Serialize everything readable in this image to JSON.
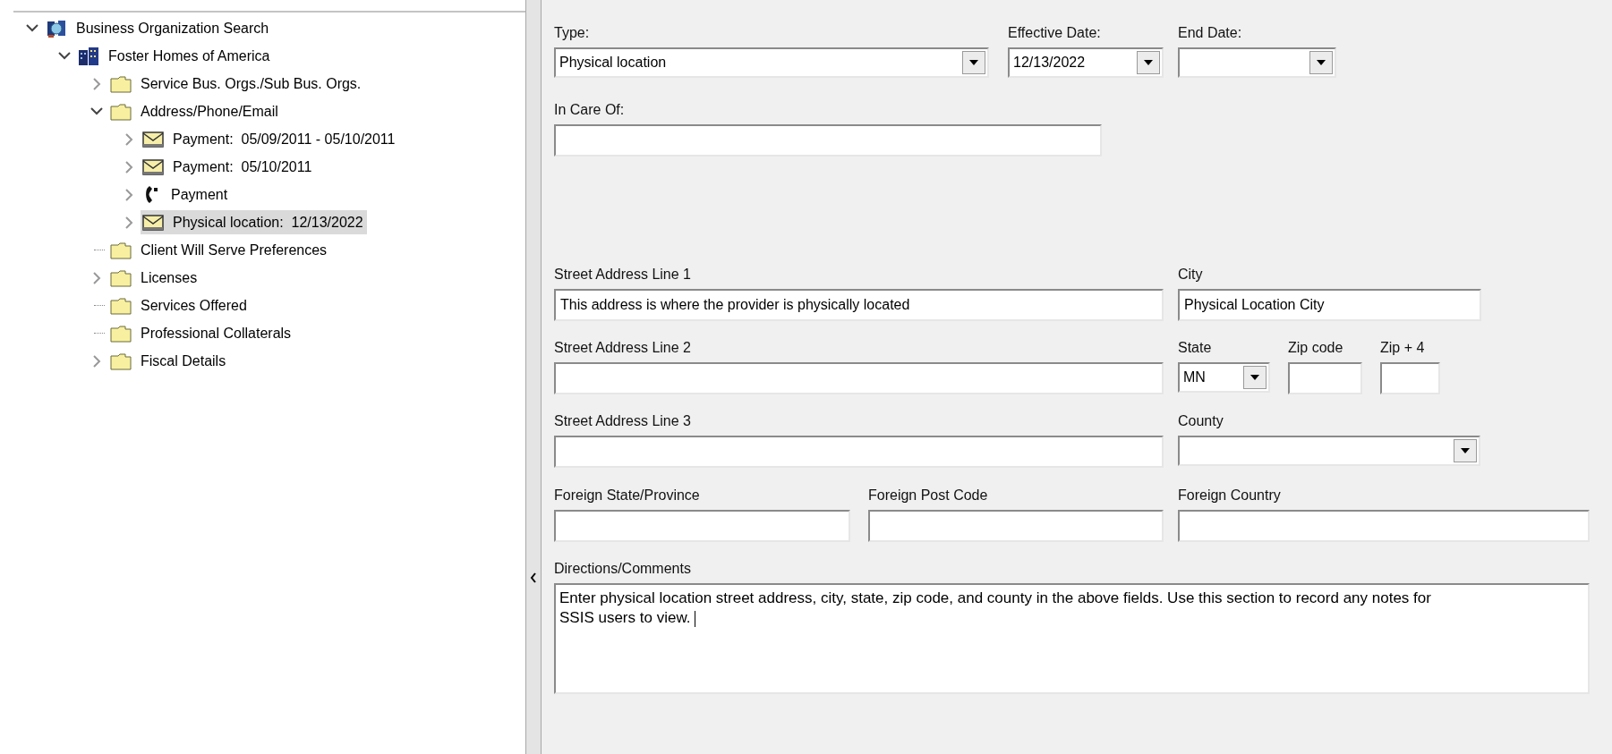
{
  "tree": {
    "items": [
      {
        "label": "Business Organization Search",
        "kind": "search",
        "expandable": true,
        "expanded": true,
        "selected": false,
        "children": [
          {
            "label": "Foster Homes of America",
            "kind": "building",
            "expandable": true,
            "expanded": true,
            "selected": false,
            "children": [
              {
                "label": "Service Bus. Orgs./Sub Bus. Orgs.",
                "kind": "folder",
                "expandable": true,
                "expanded": false,
                "selected": false
              },
              {
                "label": "Address/Phone/Email",
                "kind": "folder",
                "expandable": true,
                "expanded": true,
                "selected": false,
                "children": [
                  {
                    "label": "Payment:  05/09/2011 - 05/10/2011",
                    "kind": "envelope",
                    "expandable": true,
                    "expanded": false,
                    "selected": false
                  },
                  {
                    "label": "Payment:  05/10/2011",
                    "kind": "envelope",
                    "expandable": true,
                    "expanded": false,
                    "selected": false
                  },
                  {
                    "label": "Payment",
                    "kind": "phone",
                    "expandable": true,
                    "expanded": false,
                    "selected": false
                  },
                  {
                    "label": "Physical location:  12/13/2022",
                    "kind": "envelope",
                    "expandable": true,
                    "expanded": false,
                    "selected": true
                  }
                ]
              },
              {
                "label": "Client Will Serve Preferences",
                "kind": "folder",
                "expandable": false,
                "selected": false
              },
              {
                "label": "Licenses",
                "kind": "folder",
                "expandable": true,
                "expanded": false,
                "selected": false
              },
              {
                "label": "Services Offered",
                "kind": "folder",
                "expandable": false,
                "selected": false
              },
              {
                "label": "Professional Collaterals",
                "kind": "folder",
                "expandable": false,
                "selected": false
              },
              {
                "label": "Fiscal Details",
                "kind": "folder",
                "expandable": true,
                "expanded": false,
                "selected": false
              }
            ]
          }
        ]
      }
    ]
  },
  "form": {
    "rows": [
      [
        {
          "kind": "dropdown",
          "label": "Type:",
          "value": "Physical location"
        },
        {
          "kind": "dropdown",
          "label": "Effective Date:",
          "value": "12/13/2022"
        },
        {
          "kind": "dropdown",
          "label": "End Date:"
        }
      ],
      [
        {
          "kind": "text",
          "label": "In Care Of:"
        }
      ],
      [
        {
          "kind": "text",
          "label": "Street Address Line 1",
          "value": "This address is where the provider is physically located"
        },
        {
          "kind": "text",
          "label": "City",
          "value": "Physical Location City"
        }
      ],
      [
        {
          "kind": "text",
          "label": "Street Address Line 2"
        },
        {
          "kind": "dropdown",
          "label": "State",
          "value": "MN"
        },
        {
          "kind": "text",
          "label": "Zip code"
        },
        {
          "kind": "text",
          "label": "Zip + 4"
        }
      ],
      [
        {
          "kind": "text",
          "label": "Street Address Line 3"
        },
        {
          "kind": "dropdown",
          "label": "County"
        }
      ],
      [
        {
          "kind": "text",
          "label": "Foreign State/Province"
        },
        {
          "kind": "text",
          "label": "Foreign Post Code"
        },
        {
          "kind": "text",
          "label": "Foreign Country"
        }
      ],
      [
        {
          "kind": "textarea",
          "label": "Directions/Comments",
          "value": "Enter physical location street address, city, state, zip code, and county in the above fields. Use this section to record any notes for SSIS users to view. ",
          "focused": true
        }
      ]
    ]
  }
}
